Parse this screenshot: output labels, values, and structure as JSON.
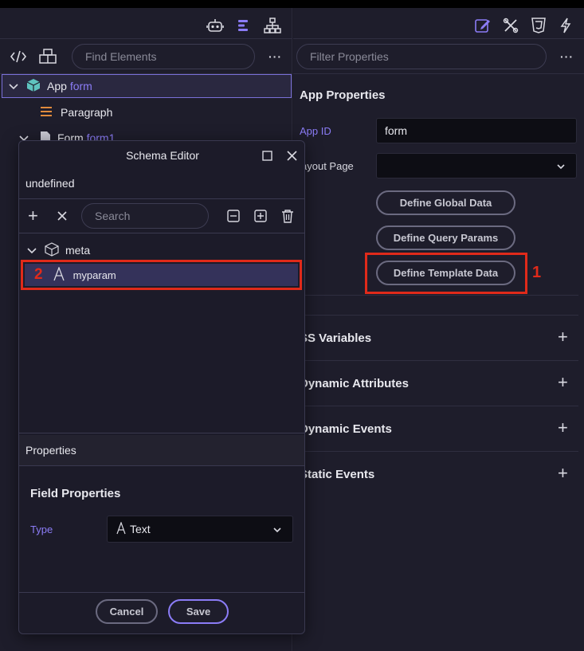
{
  "left": {
    "find_placeholder": "Find Elements",
    "more": "···",
    "tree": [
      {
        "label": "App",
        "sub": "form"
      },
      {
        "label": "Paragraph"
      },
      {
        "label": "Form",
        "sub": "form1"
      }
    ]
  },
  "right": {
    "filter_placeholder": "Filter Properties",
    "more": "···",
    "title": "App Properties",
    "app_id_label": "App ID",
    "app_id_value": "form",
    "layout_label": "ayout Page",
    "buttons": {
      "global": "Define Global Data",
      "query": "Define Query Params",
      "template": "Define Template Data"
    },
    "sections": [
      "SS Variables",
      "Dynamic Attributes",
      "Dynamic Events",
      "Static Events"
    ]
  },
  "modal": {
    "title": "Schema Editor",
    "subtitle": "undefined",
    "search_placeholder": "Search",
    "tree": {
      "root": "meta",
      "child": "myparam"
    },
    "properties_header": "Properties",
    "field_props_title": "Field Properties",
    "type_label": "Type",
    "type_value": "Text",
    "cancel": "Cancel",
    "save": "Save"
  },
  "annotations": {
    "one": "1",
    "two": "2"
  },
  "colors": {
    "accent": "#8b7cf6",
    "highlight": "#e02a1a",
    "panel": "#1e1d2b"
  }
}
